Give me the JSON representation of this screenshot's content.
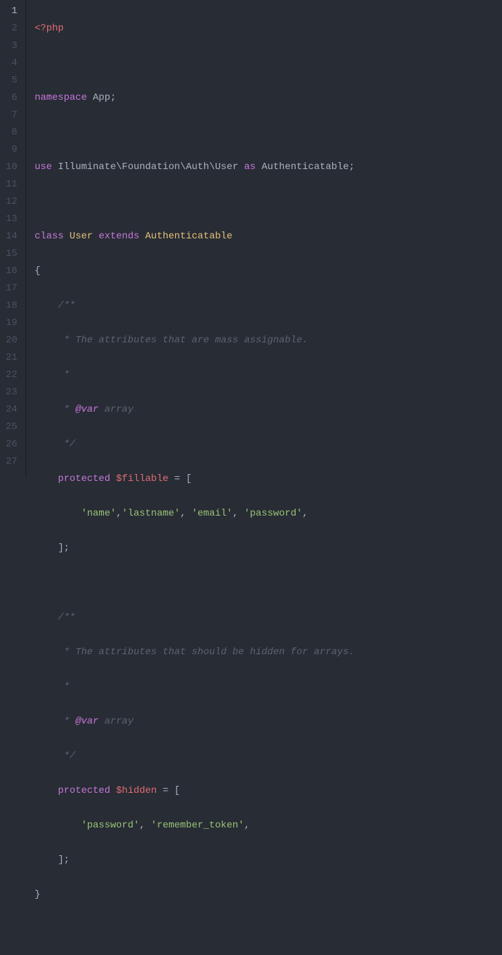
{
  "lineCount": 27,
  "activeLine": 1,
  "tokens": {
    "line1": {
      "openTag": "<?php"
    },
    "line3": {
      "kw_namespace": "namespace",
      "ns_App": "App",
      "semi": ";"
    },
    "line5": {
      "kw_use": "use",
      "ns_Illuminate": "Illuminate",
      "ns_Foundation": "Foundation",
      "ns_Auth": "Auth",
      "ns_User": "User",
      "kw_as": "as",
      "cls_Authenticatable": "Authenticatable",
      "semi": ";"
    },
    "line7": {
      "kw_class": "class",
      "cls_User": "User",
      "kw_extends": "extends",
      "cls_Authenticatable": "Authenticatable"
    },
    "line8": {
      "brace": "{"
    },
    "line9": {
      "comment": "/**"
    },
    "line10": {
      "comment": " * The attributes that are mass assignable."
    },
    "line11": {
      "comment": " *"
    },
    "line12": {
      "star": " * ",
      "doctag": "@var",
      "type": " array"
    },
    "line13": {
      "comment": " */"
    },
    "line14": {
      "kw_protected": "protected",
      "var_fillable": "$fillable",
      "eq": " = ",
      "bracket": "["
    },
    "line15": {
      "s_name": "'name'",
      "c1": ",",
      "s_lastname": "'lastname'",
      "c2": ", ",
      "s_email": "'email'",
      "c3": ", ",
      "s_password": "'password'",
      "c4": ","
    },
    "line16": {
      "bracket": "];"
    },
    "line18": {
      "comment": "/**"
    },
    "line19": {
      "comment": " * The attributes that should be hidden for arrays."
    },
    "line20": {
      "comment": " *"
    },
    "line21": {
      "star": " * ",
      "doctag": "@var",
      "type": " array"
    },
    "line22": {
      "comment": " */"
    },
    "line23": {
      "kw_protected": "protected",
      "var_hidden": "$hidden",
      "eq": " = ",
      "bracket": "["
    },
    "line24": {
      "s_password": "'password'",
      "c1": ", ",
      "s_remember": "'remember_token'",
      "c2": ","
    },
    "line25": {
      "bracket": "];"
    },
    "line26": {
      "brace": "}"
    }
  }
}
